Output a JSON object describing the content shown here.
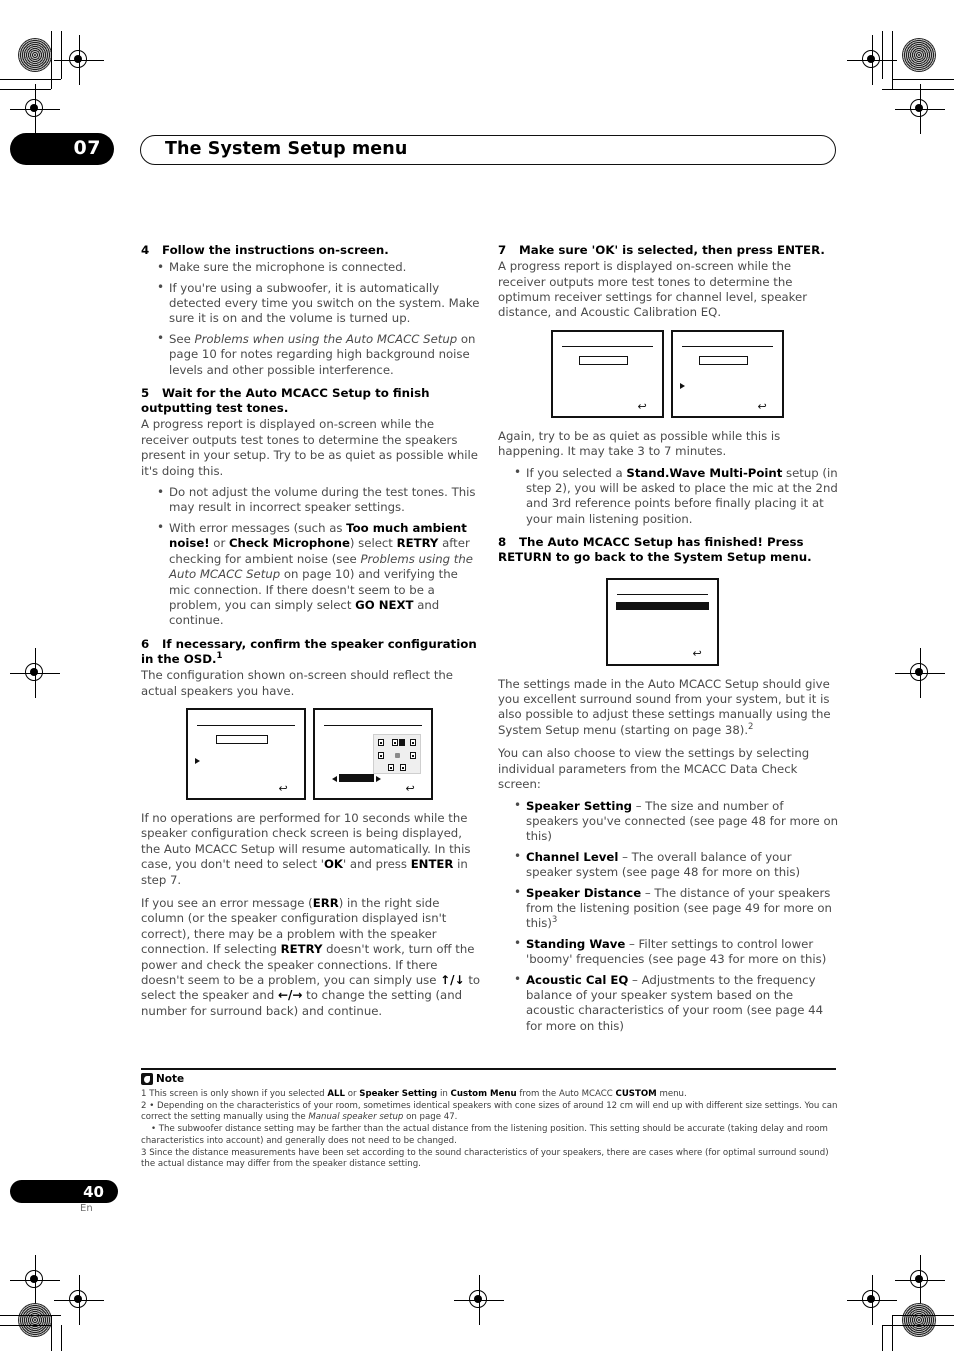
{
  "page": {
    "chapter_number": "07",
    "title": "The System Setup menu",
    "page_number": "40",
    "language_code": "En"
  },
  "left_column": {
    "step4": {
      "number": "4",
      "heading": "Follow the instructions on-screen.",
      "bullets": [
        "Make sure the microphone is connected.",
        "If you're using a subwoofer, it is automatically detected every time you switch on the system. Make sure it is on and the volume is turned up.",
        "See Problems when using the Auto MCACC Setup on page 10 for notes regarding high background noise levels and other possible interference."
      ],
      "bullet3_italic": "Problems when using the Auto MCACC Setup"
    },
    "step5": {
      "number": "5",
      "heading": "Wait for the Auto MCACC Setup to finish outputting test tones.",
      "body": "A progress report is displayed on-screen while the receiver outputs test tones to determine the speakers present in your setup. Try to be as quiet as possible while it's doing this.",
      "bullet1": "Do not adjust the volume during the test tones. This may result in incorrect speaker settings.",
      "bullet2_parts": {
        "a": "With error messages (such as ",
        "b1": "Too much ambient noise!",
        "c": " or ",
        "b2": "Check Microphone",
        "d": ") select ",
        "b3": "RETRY",
        "e": " after checking for ambient noise (see ",
        "i1": "Problems using the Auto MCACC Setup",
        "f": " on page 10) and verifying the mic connection. If there doesn't seem to be a problem, you can simply select ",
        "b4": "GO NEXT",
        "g": " and continue."
      }
    },
    "step6": {
      "number": "6",
      "heading": "If necessary, confirm the speaker configuration in the OSD.",
      "heading_footnote": "1",
      "body": "The configuration shown on-screen should reflect the actual speakers you have."
    },
    "after_fig_para1_parts": {
      "a": "If no operations are performed for 10 seconds while the speaker configuration check screen is being displayed, the Auto MCACC Setup will resume automatically. In this case, you don't need to select '",
      "b1": "OK",
      "c": "' and press ",
      "b2": "ENTER",
      "d": " in step 7."
    },
    "after_fig_para2_parts": {
      "a": "If you see an error message (",
      "b1": "ERR",
      "c": ") in the right side column (or the speaker configuration displayed isn't correct), there may be a problem with the speaker connection. If selecting ",
      "b2": "RETRY",
      "d": " doesn't work, turn off the power and check the speaker connections. If there doesn't seem to be a problem, you can simply use ",
      "arrows1": "↑/↓",
      "e": " to select the speaker and ",
      "arrows2": "←/→",
      "f": " to change the setting (and number for surround back) and continue."
    }
  },
  "right_column": {
    "step7": {
      "number": "7",
      "heading": "Make sure 'OK' is selected, then press ENTER.",
      "body": "A progress report is displayed on-screen while the receiver outputs more test tones to determine the optimum receiver settings for channel level, speaker distance, and Acoustic Calibration EQ."
    },
    "after_fig_para": "Again, try to be as quiet as possible while this is happening. It may take 3 to 7 minutes.",
    "bullet_stand_wave_parts": {
      "a": "If you selected a ",
      "b1": "Stand.Wave Multi-Point",
      "c": " setup (in step 2), you will be asked to place the mic at the 2nd and 3rd reference points before finally placing it at your main listening position."
    },
    "step8": {
      "number": "8",
      "heading": "The Auto MCACC Setup has finished! Press RETURN to go back to the System Setup menu."
    },
    "settings_para_parts": {
      "a": "The settings made in the Auto MCACC Setup should give you excellent surround sound from your system, but it is also possible to adjust these settings manually using the System Setup menu (starting on page 38).",
      "footnote": "2"
    },
    "data_check_intro": "You can also choose to view the settings by selecting individual parameters from the MCACC Data Check screen:",
    "data_check_items": [
      {
        "term": "Speaker Setting",
        "desc": " – The size and number of speakers you've connected (see page 48 for more on this)",
        "footnote": ""
      },
      {
        "term": "Channel Level",
        "desc": " – The overall balance of your speaker system (see page 48 for more on this)",
        "footnote": ""
      },
      {
        "term": "Speaker Distance",
        "desc": " – The distance of your speakers from the listening position (see page 49 for more on this)",
        "footnote": "3"
      },
      {
        "term": "Standing Wave",
        "desc": " – Filter settings to control lower 'boomy' frequencies (see page 43 for more on this)",
        "footnote": ""
      },
      {
        "term": "Acoustic Cal EQ",
        "desc": " – Adjustments to the frequency balance of your speaker system based on the acoustic characteristics of your room (see page 44 for more on this)",
        "footnote": ""
      }
    ]
  },
  "notes": {
    "title": "Note",
    "note1_parts": {
      "a": "1 This screen is only shown if you selected ",
      "b1": "ALL",
      "c": " or ",
      "b2": "Speaker Setting",
      "d": " in ",
      "b3": "Custom Menu",
      "e": " from the Auto MCACC ",
      "b4": "CUSTOM",
      "f": " menu."
    },
    "note2_parts": {
      "a": "2 • Depending on the characteristics of your room, sometimes identical speakers with cone sizes of around 12 cm will end up with different size settings. You can correct the setting manually using the ",
      "i1": "Manual speaker setup",
      "b": " on page 47."
    },
    "note2b": "• The subwoofer distance setting may be farther than the actual distance from the listening position. This setting should be accurate (taking delay and room characteristics into account) and generally does not need to be changed.",
    "note3": "3 Since the distance measurements have been set according to the sound characteristics of your speakers, there are cases where (for optimal surround sound) the actual distance may differ from the speaker distance setting."
  },
  "figures": {
    "step6_left": {
      "name": "osd-speaker-config-left"
    },
    "step6_right": {
      "name": "osd-speaker-config-right"
    },
    "step7_left": {
      "name": "osd-progress-left"
    },
    "step7_right": {
      "name": "osd-progress-right"
    },
    "step8": {
      "name": "osd-finished"
    }
  },
  "colors": {
    "ink": "#000000",
    "body_text": "#4a4a4a",
    "paper": "#ffffff"
  }
}
